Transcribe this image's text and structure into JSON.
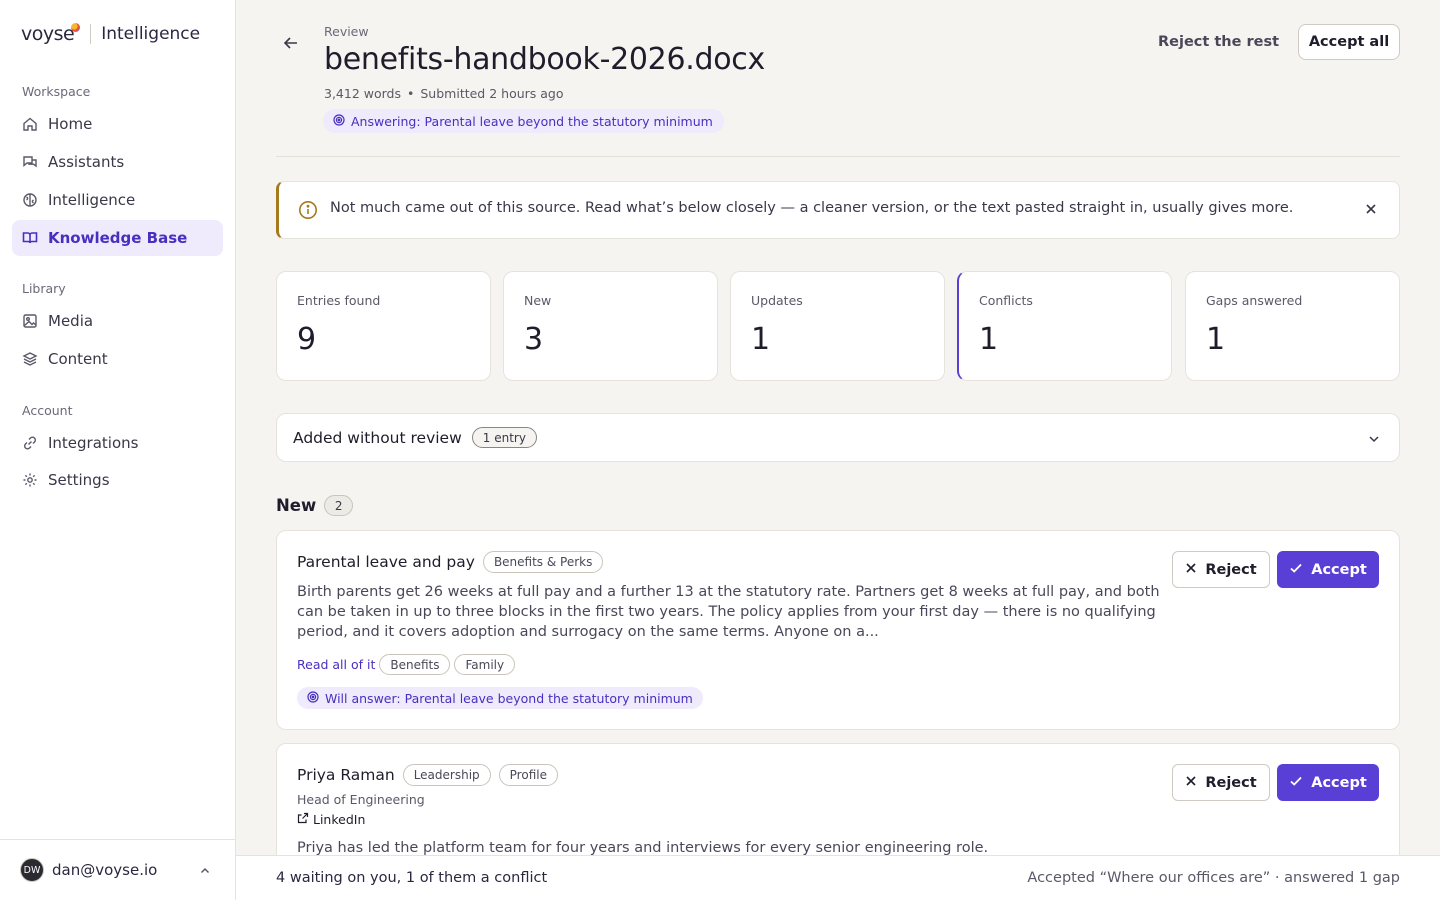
{
  "brand": {
    "logo": "voyse",
    "product": "Intelligence"
  },
  "sidebar": {
    "sections": [
      {
        "label": "Workspace"
      },
      {
        "label": "Library"
      },
      {
        "label": "Account"
      }
    ],
    "items": [
      {
        "label": "Home",
        "icon": "home-icon"
      },
      {
        "label": "Assistants",
        "icon": "chat-icon"
      },
      {
        "label": "Intelligence",
        "icon": "brain-icon"
      },
      {
        "label": "Knowledge Base",
        "icon": "book-icon",
        "active": true
      },
      {
        "label": "Media",
        "icon": "image-icon"
      },
      {
        "label": "Content",
        "icon": "layers-icon"
      },
      {
        "label": "Integrations",
        "icon": "link-icon"
      },
      {
        "label": "Settings",
        "icon": "gear-icon"
      }
    ],
    "user": {
      "initials": "DW",
      "email": "dan@voyse.io"
    }
  },
  "header": {
    "eyebrow": "Review",
    "title": "benefits-handbook-2026.docx",
    "words": "3,412 words",
    "submitted": "Submitted 2 hours ago",
    "answering": "Answering: Parental leave beyond the statutory minimum",
    "reject_rest": "Reject the rest",
    "accept_all": "Accept all"
  },
  "notice": {
    "text": "Not much came out of this source. Read what’s below closely — a cleaner version, or the text pasted straight in, usually gives more."
  },
  "stats": [
    {
      "label": "Entries found",
      "value": "9"
    },
    {
      "label": "New",
      "value": "3"
    },
    {
      "label": "Updates",
      "value": "1"
    },
    {
      "label": "Conflicts",
      "value": "1"
    },
    {
      "label": "Gaps answered",
      "value": "1"
    }
  ],
  "added_without_review": {
    "title": "Added without review",
    "count": "1 entry"
  },
  "new_section": {
    "title": "New",
    "count": "2"
  },
  "cards": [
    {
      "title": "Parental leave and pay",
      "category": "Benefits & Perks",
      "body": "Birth parents get 26 weeks at full pay and a further 13 at the statutory rate. Partners get 8 weeks at full pay, and both can be taken in up to three blocks in the first two years. The policy applies from your first day — there is no qualifying period, and it covers adoption and surrogacy on the same terms. Anyone on a...",
      "read_more": "Read all of it",
      "tags": [
        "Benefits",
        "Family"
      ],
      "will_answer": "Will answer: Parental leave beyond the statutory minimum",
      "reject": "Reject",
      "accept": "Accept"
    },
    {
      "title": "Priya Raman",
      "tags": [
        "Leadership",
        "Profile"
      ],
      "subtitle": "Head of Engineering",
      "link": "LinkedIn",
      "body": "Priya has led the platform team for four years and interviews for every senior engineering role.",
      "reject": "Reject",
      "accept": "Accept"
    }
  ],
  "footer": {
    "left": "4 waiting on you, 1 of them a conflict",
    "right": "Accepted “Where our offices are” · answered 1 gap"
  }
}
